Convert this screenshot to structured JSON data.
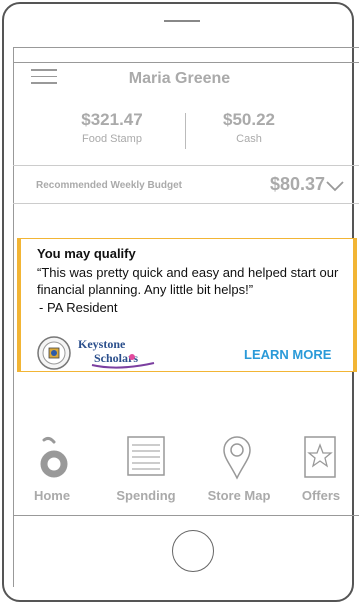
{
  "header": {
    "user_name": "Maria Greene"
  },
  "balances": [
    {
      "amount": "$321.47",
      "label": "Food Stamp"
    },
    {
      "amount": "$50.22",
      "label": "Cash"
    }
  ],
  "budget": {
    "label": "Recommended Weekly Budget",
    "amount": "$80.37"
  },
  "banner": {
    "title": "You may qualify",
    "quote": "“This was pretty quick and easy and helped start our financial planning. Any little bit helps!”",
    "author": "- PA Resident",
    "logo_text": [
      "Keystone",
      "Scholars"
    ],
    "cta": "LEARN MORE",
    "accent": "#f2b535",
    "cta_color": "#2a9ad8"
  },
  "nav": [
    {
      "label": "Home",
      "icon": "home-icon"
    },
    {
      "label": "Spending",
      "icon": "spending-icon"
    },
    {
      "label": "Store Map",
      "icon": "map-pin-icon"
    },
    {
      "label": "Offers",
      "icon": "star-icon"
    }
  ]
}
